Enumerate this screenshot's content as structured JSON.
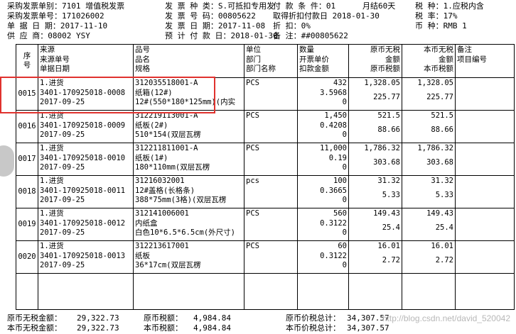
{
  "header": {
    "row1": [
      "采购发票单别：7101  增值税发票",
      "发  票  种  类：S.可抵扣专用发",
      "付  款  条  件：01",
      "月结60天",
      "税  种：1.应税内含"
    ],
    "row2": [
      "采购发票单号：171026002",
      "发  票  号  码：00805622",
      "取得折扣付款日 2018-01-30",
      "税  率：17%"
    ],
    "row3": [
      "单  据  日  期：2017-11-10",
      "发  票  日  期：2017-11-08",
      "折  扣：0%",
      "币  种：RMB    1"
    ],
    "row4": [
      "供  应  商：08002  YSY",
      "预  计  付  款  日：2018-01-30",
      "备  注：##00805622"
    ]
  },
  "table": {
    "headers": {
      "seq": [
        "序",
        "号"
      ],
      "src": [
        "来源",
        "来源单号",
        "单据日期"
      ],
      "item": [
        "品号",
        "品名",
        "规格"
      ],
      "unit": [
        "单位",
        "部门",
        "部门名称"
      ],
      "qty": [
        "数量",
        "开票单价",
        "扣款金额"
      ],
      "foreign": [
        "原币无税",
        "金额",
        "原币税额"
      ],
      "local": [
        "本币无税",
        "金额",
        "本币税额"
      ],
      "note": [
        "备注",
        "项目编号"
      ]
    },
    "rows": [
      {
        "seq": "0015",
        "src": [
          "1.进货",
          "3401-170925018-0008",
          "2017-09-25"
        ],
        "item": [
          "312035518001-A",
          "纸箱(12#)",
          "12#(550*180*125mm)(内实"
        ],
        "unit": "PCS",
        "qty": [
          "432",
          "3.5968",
          "0"
        ],
        "foreign": [
          "1,328.05",
          "225.77"
        ],
        "local": [
          "1,328.05",
          "225.77"
        ]
      },
      {
        "seq": "0016",
        "src": [
          "1.进货",
          "3401-170925018-0009",
          "2017-09-25"
        ],
        "item": [
          "312219113001-A",
          "纸板(2#)",
          "510*154(双层瓦楞"
        ],
        "unit": "PCS",
        "qty": [
          "1,450",
          "0.4208",
          "0"
        ],
        "foreign": [
          "521.5",
          "88.66"
        ],
        "local": [
          "521.5",
          "88.66"
        ]
      },
      {
        "seq": "0017",
        "src": [
          "1.进货",
          "3401-170925018-0010",
          "2017-09-25"
        ],
        "item": [
          "312211811001-A",
          "纸板(1#)",
          "180*110mm(双层瓦楞"
        ],
        "unit": "PCS",
        "qty": [
          "11,000",
          "0.19",
          "0"
        ],
        "foreign": [
          "1,786.32",
          "303.68"
        ],
        "local": [
          "1,786.32",
          "303.68"
        ]
      },
      {
        "seq": "0018",
        "src": [
          "1.进货",
          "3401-170925018-0011",
          "2017-09-25"
        ],
        "item": [
          "31216032001",
          "12#盖格(长格条)",
          "388*75mm(3格)(双层瓦楞"
        ],
        "unit": "pcs",
        "qty": [
          "100",
          "0.3665",
          "0"
        ],
        "foreign": [
          "31.32",
          "5.33"
        ],
        "local": [
          "31.32",
          "5.33"
        ]
      },
      {
        "seq": "0019",
        "src": [
          "1.进货",
          "3401-170925018-0012",
          "2017-09-25"
        ],
        "item": [
          "312141006001",
          "内纸盒",
          "白色10*6.5*6.5cm(外尺寸)"
        ],
        "unit": "PCS",
        "qty": [
          "560",
          "0.3122",
          "0"
        ],
        "foreign": [
          "149.43",
          "25.4"
        ],
        "local": [
          "149.43",
          "25.4"
        ]
      },
      {
        "seq": "0020",
        "src": [
          "1.进货",
          "3401-170925018-0013",
          "2017-09-25"
        ],
        "item": [
          "312213617001",
          "纸板",
          "36*17cm(双层瓦楞"
        ],
        "unit": "PCS",
        "qty": [
          "60",
          "0.3122",
          "0"
        ],
        "foreign": [
          "16.01",
          "2.72"
        ],
        "local": [
          "16.01",
          "2.72"
        ]
      }
    ]
  },
  "footer": {
    "foreign_untaxed_label": "原币无税金额：",
    "foreign_untaxed": "29,322.73",
    "foreign_tax_label": "原币税额：",
    "foreign_tax": "4,984.84",
    "foreign_total_label": "原币价税总计：",
    "foreign_total": "34,307.57",
    "local_untaxed_label": "本币无税金额：",
    "local_untaxed": "29,322.73",
    "local_tax_label": "本币税额：",
    "local_tax": "4,984.84",
    "local_total_label": "本币价税总计：",
    "local_total": "34,307.57"
  },
  "watermark": "http://blog.csdn.net/david_520042",
  "colors": {
    "highlight": "#e0322e",
    "text": "#000000"
  }
}
